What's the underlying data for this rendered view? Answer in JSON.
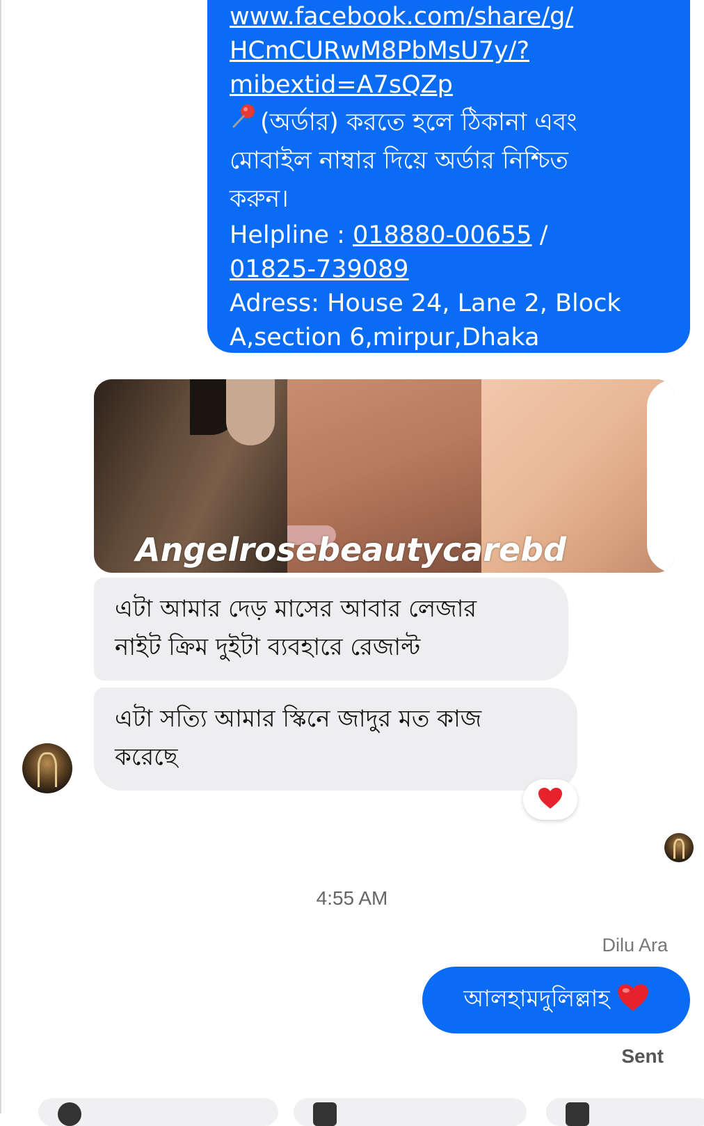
{
  "top_bubble": {
    "link_lines": [
      "www.facebook.com/share/g/",
      "HCmCURwM8PbMsU7y/?",
      "mibextid=A7sQZp"
    ],
    "pin_icon": "pushpin",
    "order_text_1": "(অর্ডার) করতে হলে ঠিকানা এবং",
    "order_text_2": "মোবাইল নাম্বার দিয়ে অর্ডার নিশ্চিত",
    "order_text_3": "করুন।",
    "helpline_label": "Helpline : ",
    "phone_1": "018880-00655",
    "phone_sep": " /",
    "phone_2": "01825-739089",
    "address_1": "Adress: House 24, Lane 2, Block",
    "address_2": "A,section 6,mirpur,Dhaka"
  },
  "collage": {
    "watermark": "Angelrosebeautycarebd"
  },
  "incoming": {
    "msg_1_line_1": "এটা আমার দেড় মাসের আবার লেজার",
    "msg_1_line_2": "নাইট ক্রিম দুইটা ব্যবহারে রেজাল্ট",
    "msg_2_line_1": "এটা সত্যি আমার স্কিনে জাদুর মত কাজ",
    "msg_2_line_2": "করেছে",
    "reaction_icon": "heart",
    "reaction_color": "#e8222d"
  },
  "timestamp": "4:55 AM",
  "outgoing": {
    "sender_name": "Dilu Ara",
    "text": "আলহামদুলিল্লাহ",
    "emoji_icon": "heart",
    "status": "Sent"
  },
  "colors": {
    "bubble_blue": "#0a6cf5",
    "bubble_gray": "#eeeef0"
  }
}
